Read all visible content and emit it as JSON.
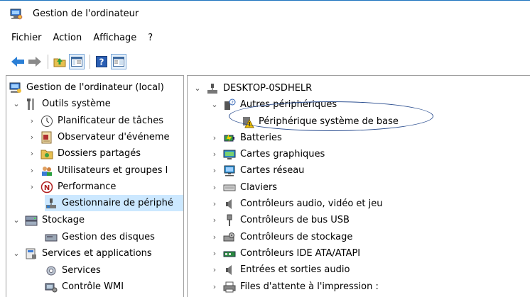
{
  "window": {
    "title": "Gestion de l'ordinateur"
  },
  "menu": {
    "file": "Fichier",
    "action": "Action",
    "view": "Affichage",
    "help": "?"
  },
  "toolbar": {
    "back_icon": "arrow-left-icon",
    "forward_icon": "arrow-right-icon",
    "up_icon": "folder-up-icon",
    "show_tree_icon": "console-tree-icon",
    "help_icon": "help-icon",
    "properties_icon": "properties-icon"
  },
  "tree": {
    "root": "Gestion de l'ordinateur (local)",
    "system_tools": "Outils système",
    "task_scheduler": "Planificateur de tâches",
    "event_viewer": "Observateur d'événeme",
    "shared_folders": "Dossiers partagés",
    "local_users": "Utilisateurs et groupes l",
    "performance": "Performance",
    "device_manager": "Gestionnaire de périphé",
    "storage": "Stockage",
    "disk_management": "Gestion des disques",
    "services_apps": "Services et applications",
    "services": "Services",
    "wmi": "Contrôle WMI"
  },
  "devices": {
    "computer": "DESKTOP-0SDHELR",
    "other_devices": "Autres périphériques",
    "base_system_device": "Périphérique système de base",
    "batteries": "Batteries",
    "display": "Cartes graphiques",
    "network": "Cartes réseau",
    "keyboards": "Claviers",
    "sound": "Contrôleurs audio, vidéo et jeu",
    "usb": "Contrôleurs de bus USB",
    "storage_ctrl": "Contrôleurs de stockage",
    "ide": "Contrôleurs IDE ATA/ATAPI",
    "audio_io": "Entrées et sorties audio",
    "print_queues": "Files d'attente à l'impression :"
  }
}
